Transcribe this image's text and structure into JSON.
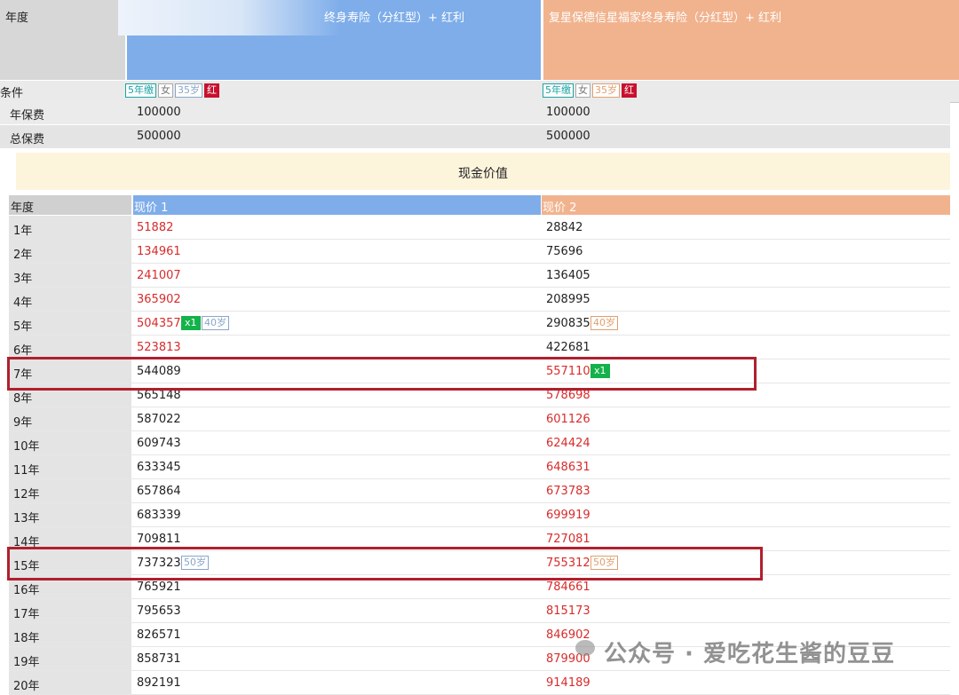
{
  "header": {
    "year_label": "年度",
    "plan1_name": "终身寿险（分红型）+ 红利",
    "plan2_name": "复星保德信星福家终身寿险（分红型）+ 红利",
    "plan1_color": "#7eadea",
    "plan2_color": "#f1b38e"
  },
  "conditions": {
    "label": "条件",
    "plan1_tags": [
      "5年缴",
      "女",
      "35岁",
      "红"
    ],
    "plan2_tags": [
      "5年缴",
      "女",
      "35岁",
      "红"
    ]
  },
  "premiums": [
    {
      "label": "年保费",
      "v1": "100000",
      "v2": "100000"
    },
    {
      "label": "总保费",
      "v1": "500000",
      "v2": "500000"
    }
  ],
  "section_title": "现金价值",
  "table": {
    "headers": [
      "年度",
      "现价 1",
      "现价 2"
    ],
    "rows": [
      {
        "year": "1年",
        "v1": "51882",
        "v2": "28842",
        "red1": true,
        "red2": false
      },
      {
        "year": "2年",
        "v1": "134961",
        "v2": "75696",
        "red1": true,
        "red2": false
      },
      {
        "year": "3年",
        "v1": "241007",
        "v2": "136405",
        "red1": true,
        "red2": false
      },
      {
        "year": "4年",
        "v1": "365902",
        "v2": "208995",
        "red1": true,
        "red2": false
      },
      {
        "year": "5年",
        "v1": "504357",
        "v2": "290835",
        "red1": true,
        "red2": false,
        "badge1": "x1",
        "age1": "40岁",
        "age2": "40岁"
      },
      {
        "year": "6年",
        "v1": "523813",
        "v2": "422681",
        "red1": true,
        "red2": false
      },
      {
        "year": "7年",
        "v1": "544089",
        "v2": "557110",
        "red1": false,
        "red2": true,
        "badge2": "x1"
      },
      {
        "year": "8年",
        "v1": "565148",
        "v2": "578698",
        "red1": false,
        "red2": true
      },
      {
        "year": "9年",
        "v1": "587022",
        "v2": "601126",
        "red1": false,
        "red2": true
      },
      {
        "year": "10年",
        "v1": "609743",
        "v2": "624424",
        "red1": false,
        "red2": true
      },
      {
        "year": "11年",
        "v1": "633345",
        "v2": "648631",
        "red1": false,
        "red2": true
      },
      {
        "year": "12年",
        "v1": "657864",
        "v2": "673783",
        "red1": false,
        "red2": true
      },
      {
        "year": "13年",
        "v1": "683339",
        "v2": "699919",
        "red1": false,
        "red2": true
      },
      {
        "year": "14年",
        "v1": "709811",
        "v2": "727081",
        "red1": false,
        "red2": true
      },
      {
        "year": "15年",
        "v1": "737323",
        "v2": "755312",
        "red1": false,
        "red2": true,
        "age1": "50岁",
        "age2": "50岁"
      },
      {
        "year": "16年",
        "v1": "765921",
        "v2": "784661",
        "red1": false,
        "red2": true
      },
      {
        "year": "17年",
        "v1": "795653",
        "v2": "815173",
        "red1": false,
        "red2": true
      },
      {
        "year": "18年",
        "v1": "826571",
        "v2": "846902",
        "red1": false,
        "red2": true
      },
      {
        "year": "19年",
        "v1": "858731",
        "v2": "879900",
        "red1": false,
        "red2": true
      },
      {
        "year": "20年",
        "v1": "892191",
        "v2": "914189",
        "red1": false,
        "red2": true
      }
    ]
  },
  "watermark": "公众号 · 爱吃花生酱的豆豆"
}
